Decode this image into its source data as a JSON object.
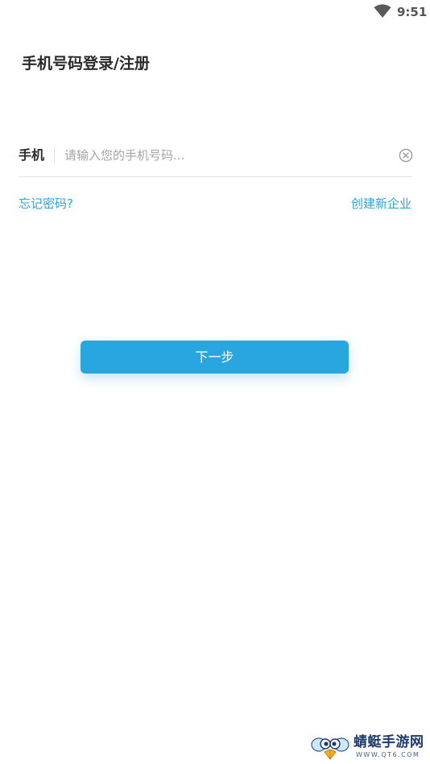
{
  "status_bar": {
    "time": "9:51",
    "wifi_icon": "wifi-icon"
  },
  "page": {
    "title": "手机号码登录/注册"
  },
  "phone_field": {
    "label": "手机",
    "value": "",
    "placeholder": "请输入您的手机号码...",
    "clear_icon": "clear-circle-icon"
  },
  "links": {
    "forgot_password": "忘记密码?",
    "create_enterprise": "创建新企业"
  },
  "next_button": {
    "label": "下一步"
  },
  "watermark": {
    "name": "蜻蜓手游网",
    "url": "WWW.QT6.COM",
    "logo_icon": "dragonfly-logo-icon"
  },
  "colors": {
    "accent": "#28a6e0",
    "link": "#2aa7dc",
    "title_text": "#2a2a2a",
    "placeholder": "#a5a5a5",
    "divider": "#e6e6e6"
  }
}
